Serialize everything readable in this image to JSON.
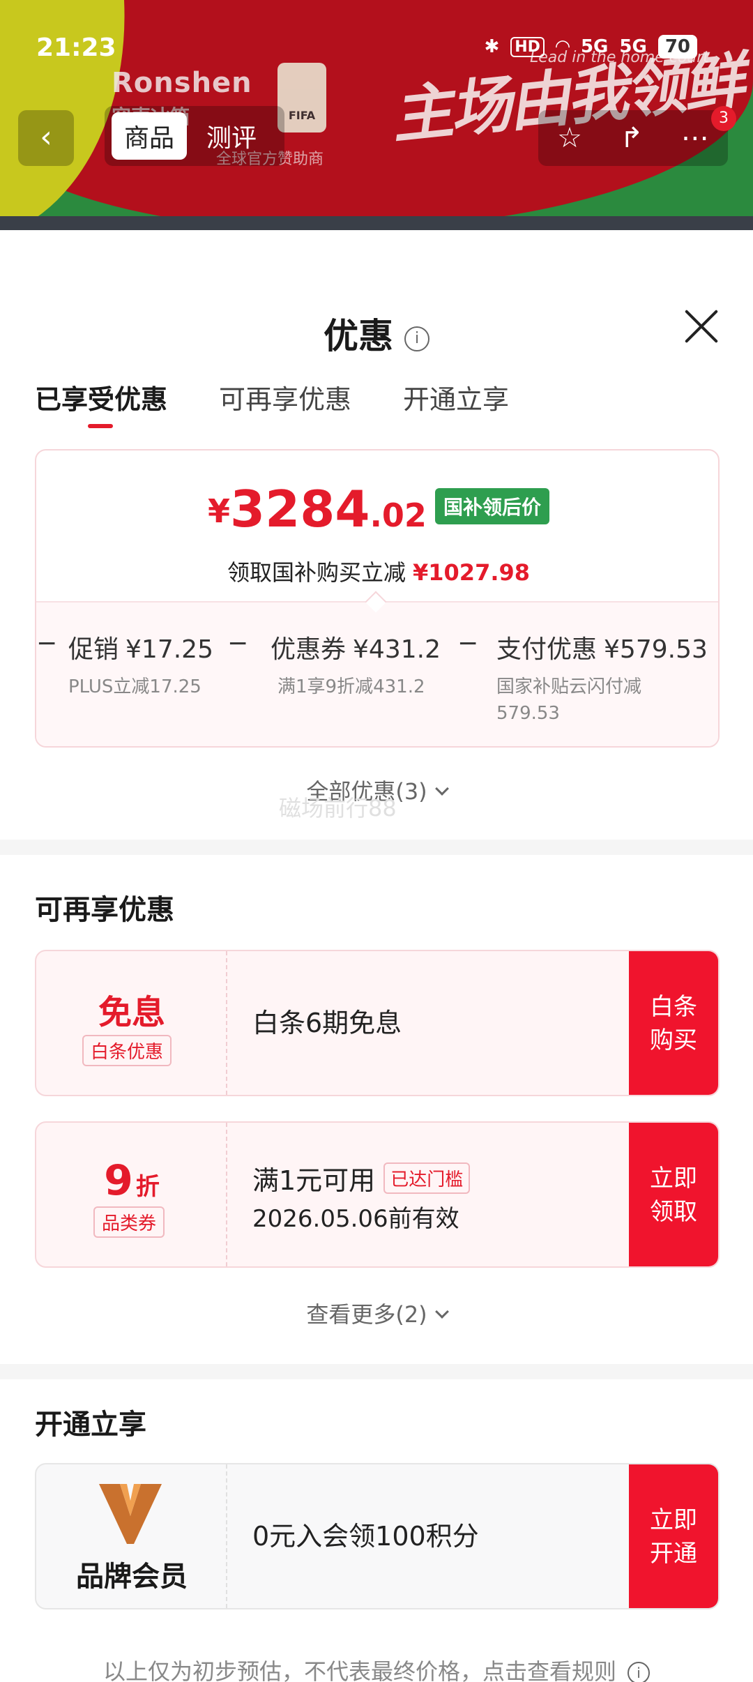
{
  "status": {
    "time": "21:23",
    "hd": "HD",
    "net1": "5G",
    "net2": "5G",
    "battery": "70"
  },
  "nav": {
    "tabs": [
      {
        "label": "商品"
      },
      {
        "label": "测评"
      }
    ],
    "badge": "3"
  },
  "banner": {
    "brand": "Ronshen",
    "brand_sub": "容声冰箱",
    "fifa": "FIFA",
    "sponsor": "全球官方赞助商",
    "slogan": "主场由我领鲜",
    "slogan_en": "Lead in the home court"
  },
  "sheet": {
    "title": "优惠",
    "tabs": [
      {
        "label": "已享受优惠"
      },
      {
        "label": "可再享优惠"
      },
      {
        "label": "开通立享"
      }
    ],
    "price": {
      "yen": "¥",
      "integer": "3284",
      "decimal": ".02",
      "tag": "国补领后价"
    },
    "subsidy": {
      "label": "领取国补购买立减",
      "amount": "¥1027.98"
    },
    "breakdown": [
      {
        "label": "促销",
        "amount": "¥17.25",
        "note": "PLUS立减17.25"
      },
      {
        "label": "优惠券",
        "amount": "¥431.2",
        "note": "满1享9折减431.2"
      },
      {
        "label": "支付优惠",
        "amount": "¥579.53",
        "note": "国家补贴云闪付减 579.53"
      }
    ],
    "all_label": "全部优惠(3)",
    "watermark": "磁场前行88"
  },
  "section2": {
    "title": "可再享优惠",
    "coupons": [
      {
        "big": "免息",
        "tag": "白条优惠",
        "desc": "白条6期免息",
        "btn": "白条购买"
      },
      {
        "big": "9",
        "big_unit": "折",
        "tag": "品类券",
        "desc": "满1元可用",
        "chip": "已达门槛",
        "date": "2026.05.06前有效",
        "btn": "立即领取"
      }
    ],
    "more_label": "查看更多(2)"
  },
  "section3": {
    "title": "开通立享",
    "item": {
      "brand": "品牌会员",
      "desc": "0元入会领100积分",
      "btn": "立即开通"
    }
  },
  "footer": "以上仅为初步预估，不代表最终价格，点击查看规则"
}
